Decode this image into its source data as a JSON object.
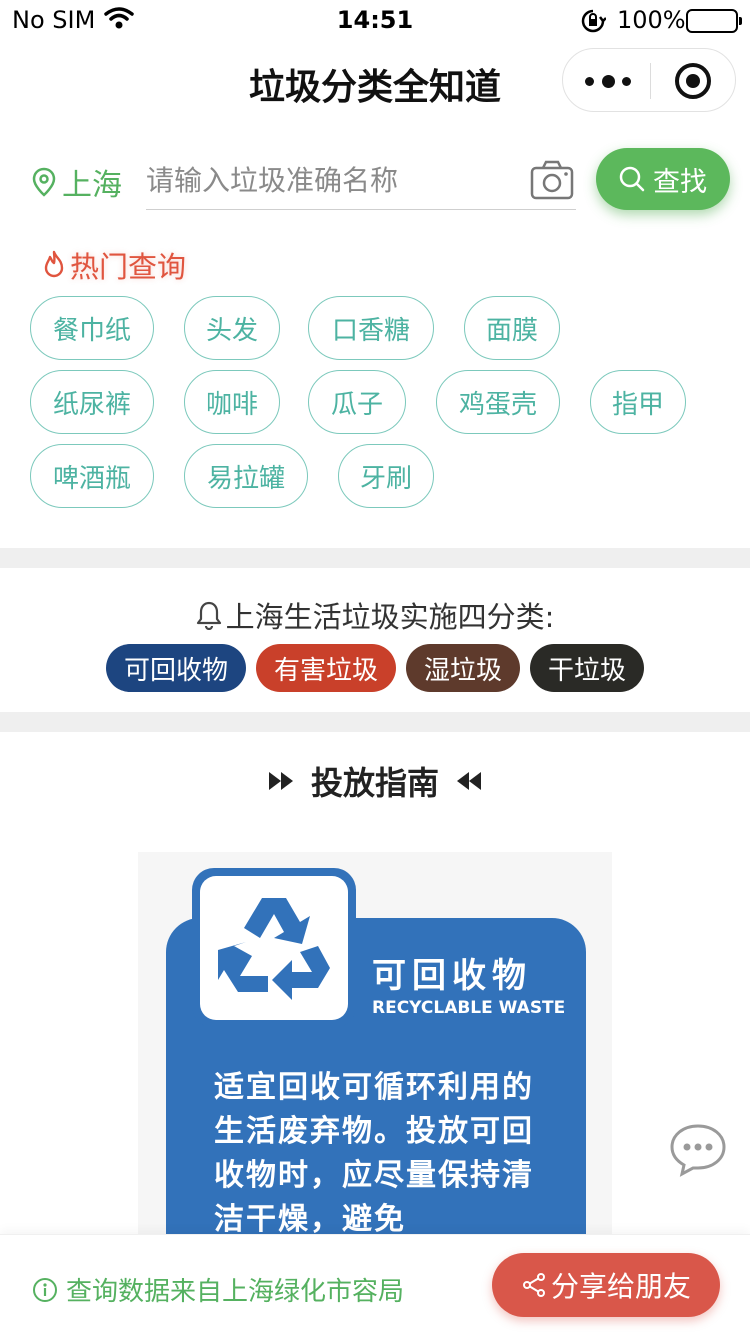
{
  "status_bar": {
    "carrier": "No SIM",
    "time": "14:51",
    "battery": "100%"
  },
  "nav": {
    "title": "垃圾分类全知道"
  },
  "search": {
    "city": "上海",
    "placeholder": "请输入垃圾准确名称",
    "button": "查找"
  },
  "hot": {
    "title": "热门查询",
    "tags": [
      "餐巾纸",
      "头发",
      "口香糖",
      "面膜",
      "纸尿裤",
      "咖啡",
      "瓜子",
      "鸡蛋壳",
      "指甲",
      "啤酒瓶",
      "易拉罐",
      "牙刷"
    ]
  },
  "categories": {
    "title": "上海生活垃圾实施四分类:",
    "items": [
      {
        "label": "可回收物",
        "color": "#1d4580"
      },
      {
        "label": "有害垃圾",
        "color": "#c9402a"
      },
      {
        "label": "湿垃圾",
        "color": "#5e3a2c"
      },
      {
        "label": "干垃圾",
        "color": "#2a2a26"
      }
    ]
  },
  "guide": {
    "title": "投放指南",
    "poster": {
      "title": "可回收物",
      "subtitle": "RECYCLABLE WASTE",
      "description": "适宜回收可循环利用的生活废弃物。投放可回收物时，应尽量保持清洁干燥，避免"
    }
  },
  "footer": {
    "source": "查询数据来自上海绿化市容局",
    "share": "分享给朋友"
  }
}
